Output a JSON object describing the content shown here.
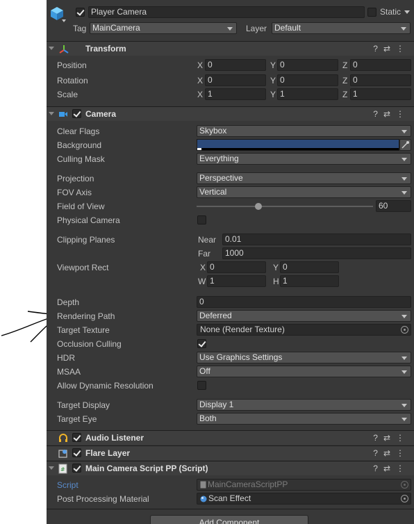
{
  "object": {
    "name": "Player Camera",
    "static_label": "Static",
    "tag_label": "Tag",
    "tag_value": "MainCamera",
    "layer_label": "Layer",
    "layer_value": "Default"
  },
  "transform": {
    "title": "Transform",
    "position_label": "Position",
    "rotation_label": "Rotation",
    "scale_label": "Scale",
    "position": {
      "x": "0",
      "y": "0",
      "z": "0"
    },
    "rotation": {
      "x": "0",
      "y": "0",
      "z": "0"
    },
    "scale": {
      "x": "1",
      "y": "1",
      "z": "1"
    }
  },
  "axes": {
    "x": "X",
    "y": "Y",
    "z": "Z",
    "w": "W",
    "h": "H"
  },
  "camera": {
    "title": "Camera",
    "clear_flags_label": "Clear Flags",
    "clear_flags": "Skybox",
    "background_label": "Background",
    "background_color": "#2c4a7a",
    "culling_mask_label": "Culling Mask",
    "culling_mask": "Everything",
    "projection_label": "Projection",
    "projection": "Perspective",
    "fov_axis_label": "FOV Axis",
    "fov_axis": "Vertical",
    "fov_label": "Field of View",
    "fov_value": "60",
    "fov_fraction": 0.35,
    "physical_label": "Physical Camera",
    "clipping_label": "Clipping Planes",
    "near_label": "Near",
    "near_value": "0.01",
    "far_label": "Far",
    "far_value": "1000",
    "viewport_label": "Viewport Rect",
    "viewport": {
      "x": "0",
      "y": "0",
      "w": "1",
      "h": "1"
    },
    "depth_label": "Depth",
    "depth": "0",
    "rendering_path_label": "Rendering Path",
    "rendering_path": "Deferred",
    "target_texture_label": "Target Texture",
    "target_texture": "None (Render Texture)",
    "occlusion_label": "Occlusion Culling",
    "hdr_label": "HDR",
    "hdr": "Use Graphics Settings",
    "msaa_label": "MSAA",
    "msaa": "Off",
    "dynres_label": "Allow Dynamic Resolution",
    "target_display_label": "Target Display",
    "target_display": "Display 1",
    "target_eye_label": "Target Eye",
    "target_eye": "Both"
  },
  "audio_listener": {
    "title": "Audio Listener"
  },
  "flare_layer": {
    "title": "Flare Layer"
  },
  "script_component": {
    "title": "Main Camera Script PP (Script)",
    "script_label": "Script",
    "script_value": "MainCameraScriptPP",
    "material_label": "Post Processing Material",
    "material_value": "Scan Effect"
  },
  "add_component_label": "Add Component"
}
